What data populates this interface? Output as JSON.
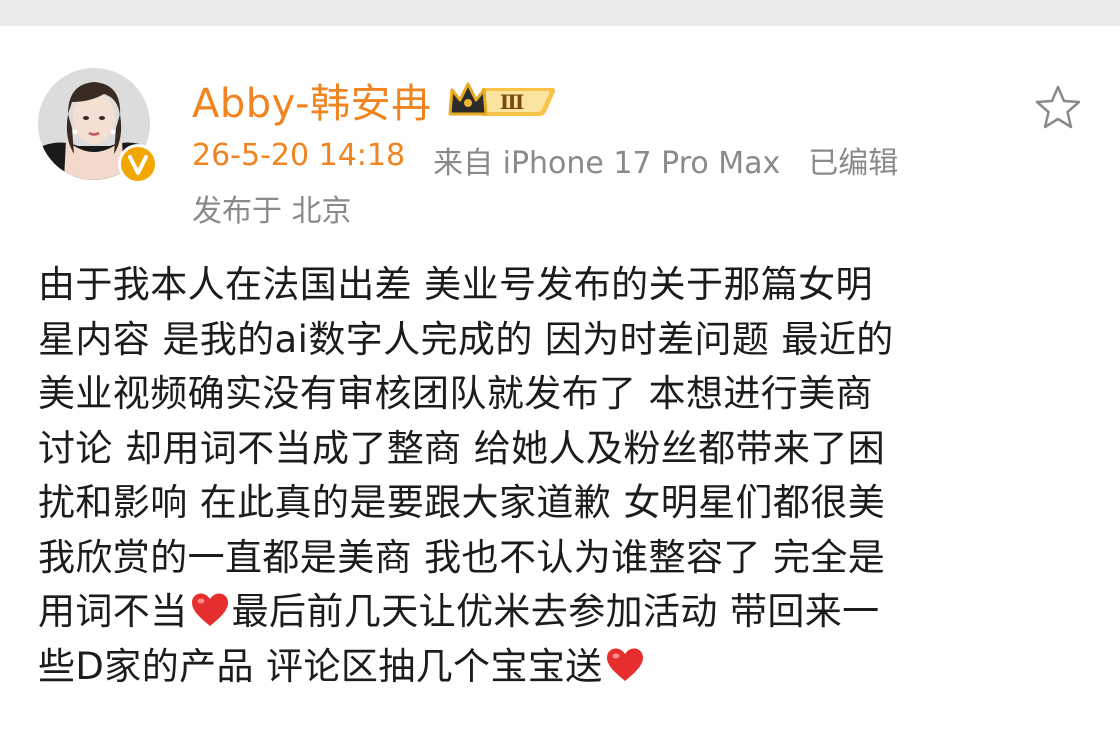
{
  "post": {
    "author": "Abby-韩安冉",
    "vip_level": "Ⅲ",
    "timestamp": "26-5-20 14:18",
    "source": "来自 iPhone 17 Pro Max",
    "edited": "已编辑",
    "location": "发布于 北京",
    "body_lines": [
      "由于我本人在法国出差 美业号发布的关于那篇女明",
      "星内容 是我的ai数字人完成的 因为时差问题 最近的",
      "美业视频确实没有审核团队就发布了 本想进行美商",
      "讨论 却用词不当成了整商 给她人及粉丝都带来了困",
      "扰和影响 在此真的是要跟大家道歉 女明星们都很美",
      "我欣赏的一直都是美商 我也不认为谁整容了 完全是",
      "用词不当",
      "最后前几天让优米去参加活动 带回来一",
      "些D家的产品 评论区抽几个宝宝送"
    ]
  },
  "colors": {
    "accent": "#f08421",
    "meta": "#8a8a8a",
    "text": "#1c1c1c",
    "heart": "#e62e2e",
    "verified": "#f2a600"
  },
  "icons": {
    "favorite": "star-outline-icon",
    "verified": "verified-v-icon",
    "vip": "crown-vip-badge-icon",
    "emoji": "red-heart-icon"
  }
}
